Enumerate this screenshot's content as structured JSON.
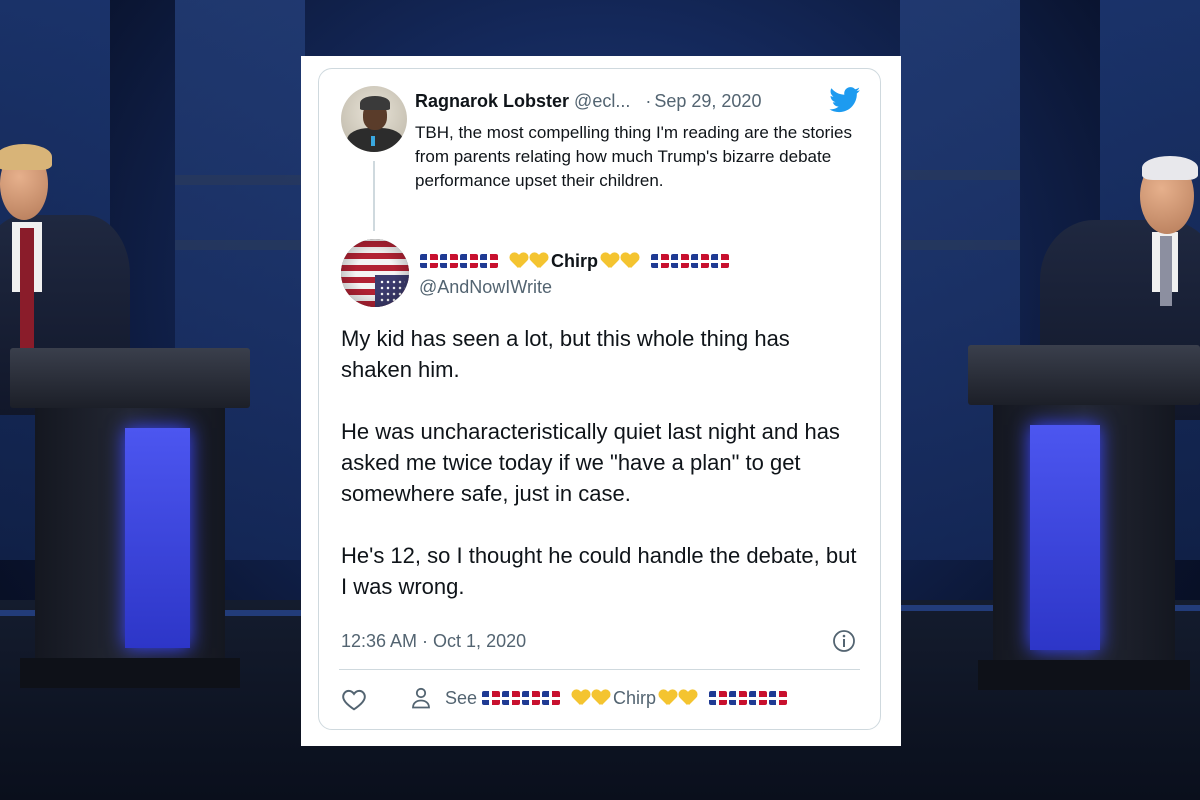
{
  "reply_to": {
    "name": "Ragnarok Lobster",
    "handle": "@ecl...",
    "separator": "·",
    "date": "Sep 29, 2020",
    "text": "TBH, the most compelling thing I'm reading are the stories from parents relating how much Trump's bizarre debate performance upset their children."
  },
  "tweet": {
    "author_name": "Chirp",
    "author_handle": "@AndNowIWrite",
    "paragraphs": [
      "My kid has seen a lot, but this whole thing has shaken him.",
      "He was uncharacteristically quiet last night and has asked me twice today if we \"have a plan\" to get somewhere safe, just in case.",
      "He's 12, so I thought he could handle the debate, but I was wrong."
    ],
    "timestamp": "12:36 AM · Oct 1, 2020"
  },
  "actions": {
    "see_label": "See",
    "see_name": "Chirp"
  },
  "icons": {
    "twitter_bird": "twitter-bird-icon",
    "info": "info-icon",
    "like": "heart-outline-icon",
    "profile": "person-icon"
  },
  "colors": {
    "twitter_blue": "#1d9bf0",
    "text_primary": "#0f1419",
    "text_secondary": "#536471",
    "border": "#cfd9de",
    "podium_glow": "#3b46ff"
  }
}
